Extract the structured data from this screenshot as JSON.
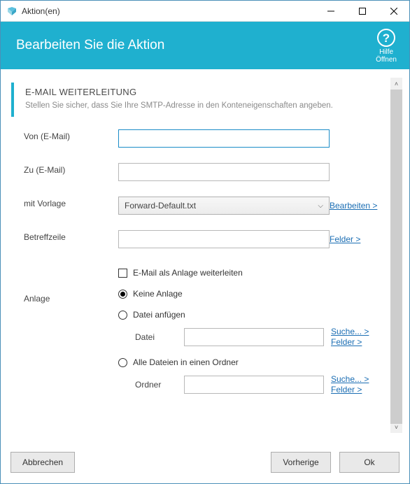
{
  "window": {
    "title": "Aktion(en)"
  },
  "header": {
    "title": "Bearbeiten Sie die Aktion",
    "help_label": "Hilfe\nÖffnen"
  },
  "section": {
    "title": "E-MAIL WEITERLEITUNG",
    "desc": "Stellen Sie sicher, dass Sie Ihre SMTP-Adresse in den Konteneigenschaften angeben."
  },
  "form": {
    "from_label": "Von (E-Mail)",
    "from_value": "",
    "to_label": "Zu (E-Mail)",
    "to_value": "",
    "template_label": "mit Vorlage",
    "template_value": "Forward-Default.txt",
    "template_edit_link": "Bearbeiten >",
    "subject_label": "Betreffzeile",
    "subject_value": "",
    "subject_fields_link": "Felder >",
    "forward_as_attachment": "E-Mail als Anlage weiterleiten",
    "attachment_label": "Anlage",
    "attach_none": "Keine Anlage",
    "attach_file": "Datei anfügen",
    "attach_file_sublabel": "Datei",
    "attach_file_value": "",
    "attach_folder": "Alle Dateien in einen Ordner",
    "attach_folder_sublabel": "Ordner",
    "attach_folder_value": "",
    "browse_link": "Suche... >",
    "fields_link": "Felder >"
  },
  "footer": {
    "cancel": "Abbrechen",
    "prev": "Vorherige",
    "ok": "Ok"
  }
}
